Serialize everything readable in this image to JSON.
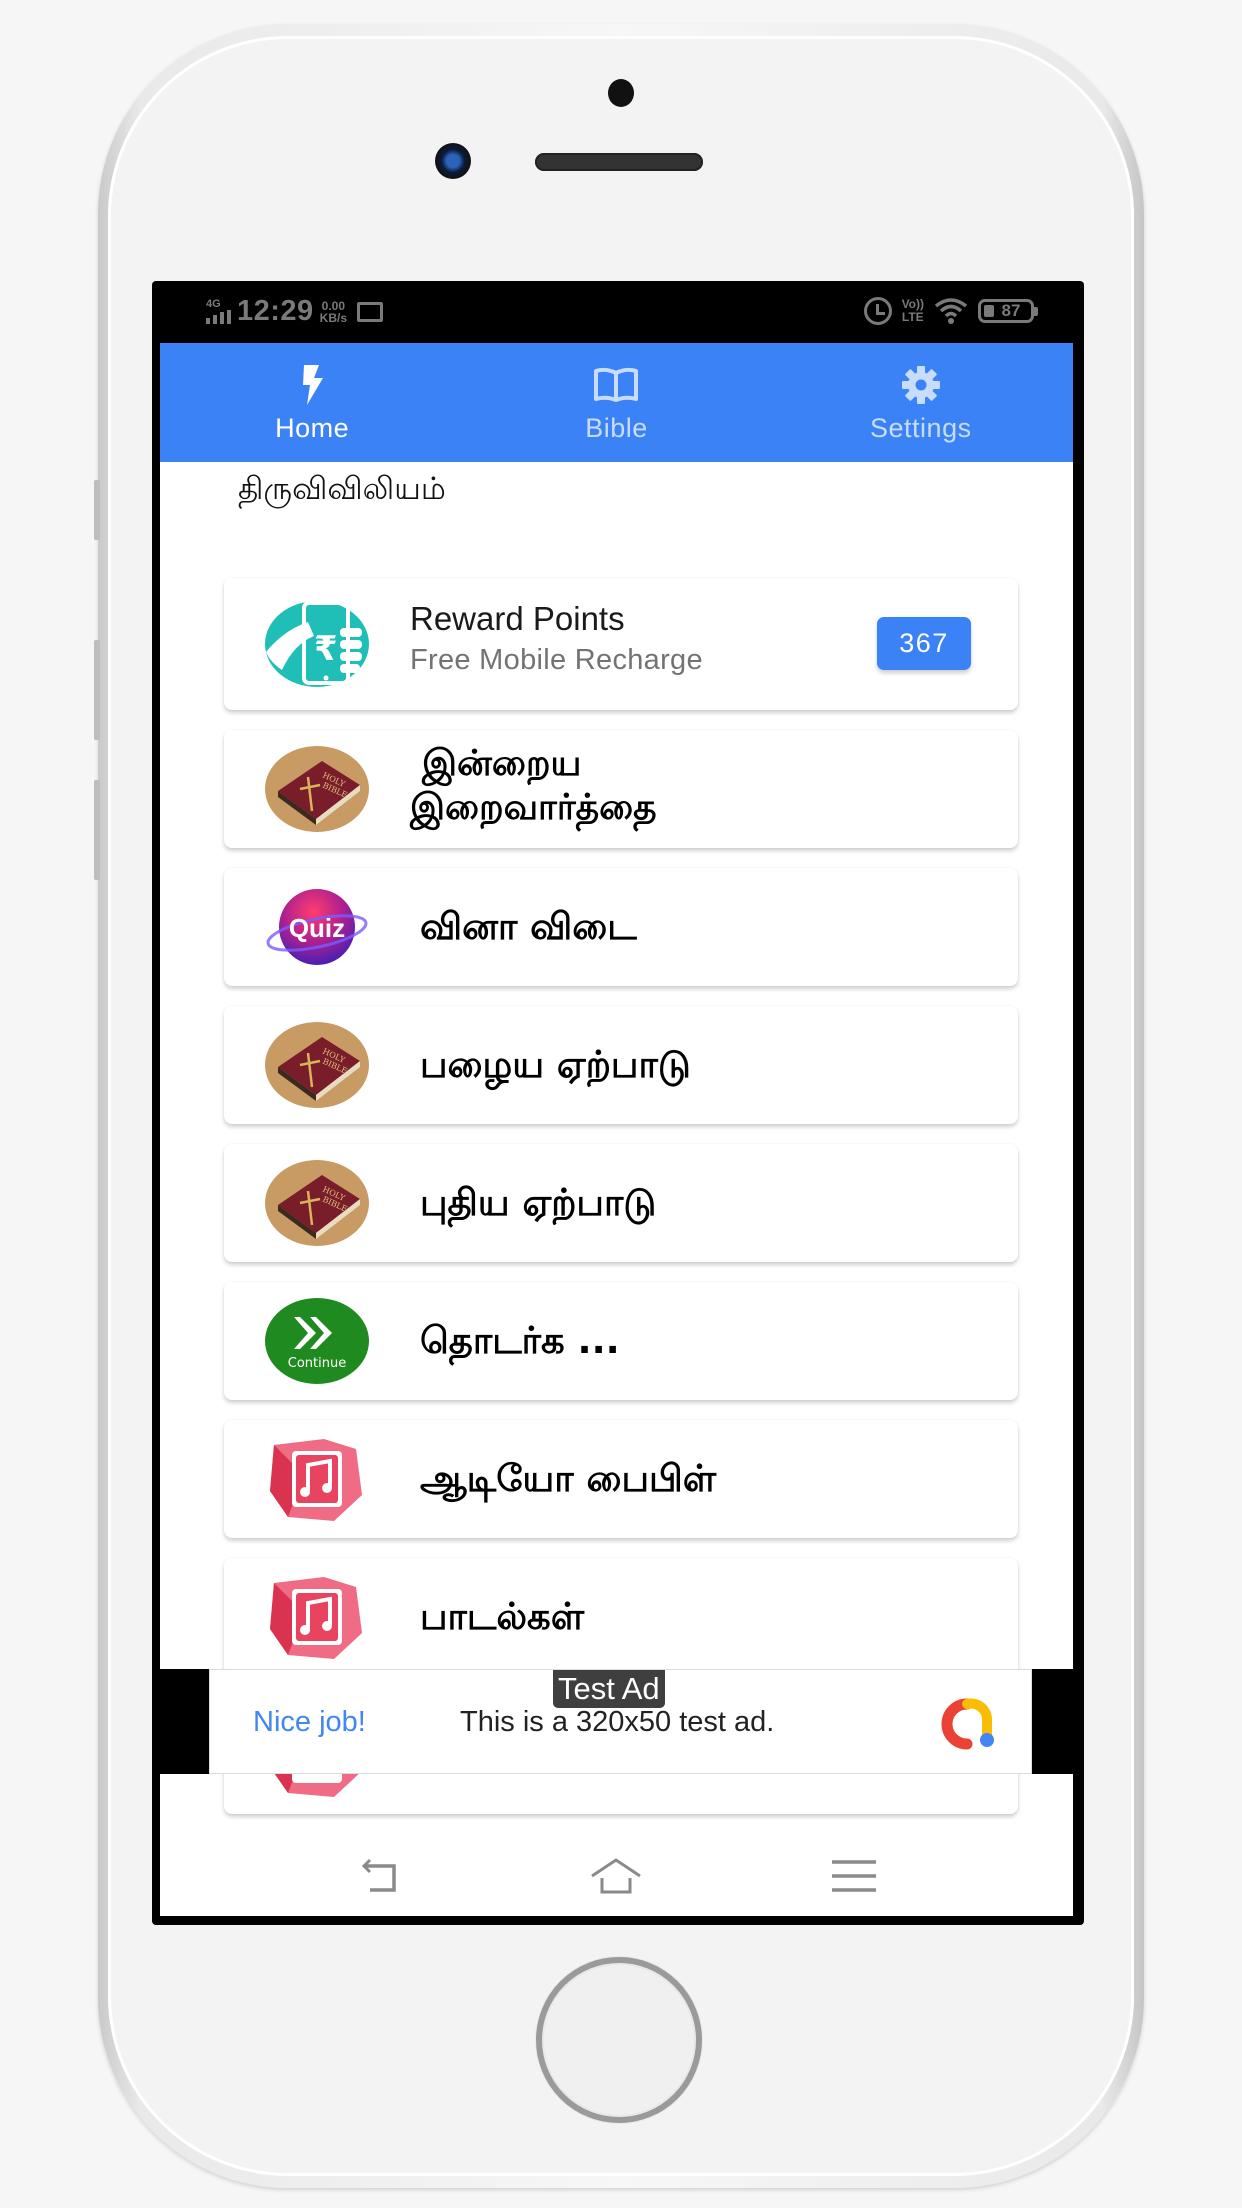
{
  "status_bar": {
    "network": "4G",
    "time": "12:29",
    "speed_value": "0.00",
    "speed_unit": "KB/s",
    "volte_top": "Vo))",
    "volte_bottom": "LTE",
    "battery": "87"
  },
  "tabs": [
    {
      "label": "Home",
      "icon": "lightning-icon",
      "active": true
    },
    {
      "label": "Bible",
      "icon": "book-icon",
      "active": false
    },
    {
      "label": "Settings",
      "icon": "gear-icon",
      "active": false
    }
  ],
  "app_title": "திருவிவிலியம்",
  "reward": {
    "title": "Reward Points",
    "subtitle": "Free Mobile Recharge",
    "points": "367",
    "icon": "mobile-recharge-icon"
  },
  "menu_items": [
    {
      "label_line1": "இன்றைய",
      "label_line2": "இறைவார்த்தை",
      "icon": "holy-bible-icon"
    },
    {
      "label": "வினா விடை",
      "icon": "quiz-icon"
    },
    {
      "label": "பழைய ஏற்பாடு",
      "icon": "holy-bible-icon"
    },
    {
      "label": "புதிய ஏற்பாடு",
      "icon": "holy-bible-icon"
    },
    {
      "label": "தொடர்க ...",
      "icon": "continue-icon",
      "icon_text": "Continue"
    },
    {
      "label": "ஆடியோ பைபிள்",
      "icon": "music-icon"
    },
    {
      "label": "பாடல்கள்",
      "icon": "music-icon"
    },
    {
      "label": "",
      "icon": "music-icon"
    }
  ],
  "ad": {
    "badge": "Test Ad",
    "cta": "Nice job!",
    "text": "This is a 320x50 test ad."
  },
  "colors": {
    "primary": "#3b82f6",
    "continue_green": "#1f8a1f",
    "music_pink": "#e8435f",
    "reward_teal": "#1fbfb8"
  }
}
